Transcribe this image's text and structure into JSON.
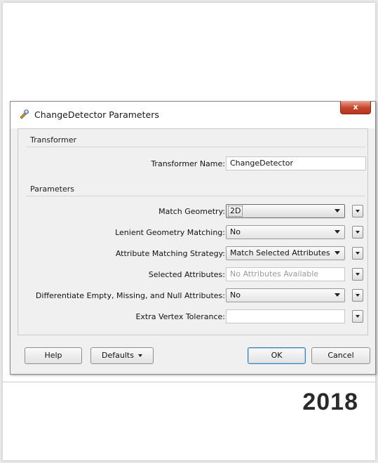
{
  "dialog": {
    "title": "ChangeDetector Parameters",
    "close_label": "x"
  },
  "transformer_section": {
    "heading": "Transformer",
    "name_label": "Transformer Name:",
    "name_value": "ChangeDetector"
  },
  "parameters_section": {
    "heading": "Parameters",
    "rows": [
      {
        "label": "Match Geometry:",
        "value": "2D",
        "control": "select"
      },
      {
        "label": "Lenient Geometry Matching:",
        "value": "No",
        "control": "select"
      },
      {
        "label": "Attribute Matching Strategy:",
        "value": "Match Selected Attributes",
        "control": "select"
      },
      {
        "label": "Selected Attributes:",
        "value": "No Attributes Available",
        "control": "text-disabled"
      },
      {
        "label": "Differentiate Empty, Missing, and Null Attributes:",
        "value": "No",
        "control": "select"
      },
      {
        "label": "Extra Vertex Tolerance:",
        "value": "",
        "control": "text"
      }
    ]
  },
  "buttons": {
    "help": "Help",
    "defaults": "Defaults",
    "ok": "OK",
    "cancel": "Cancel"
  },
  "year_caption": "2018"
}
